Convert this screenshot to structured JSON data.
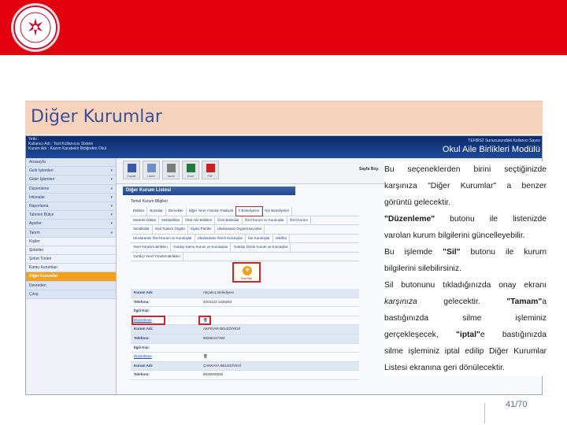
{
  "slide": {
    "title": "Diğer Kurumlar",
    "page_number": "41/70",
    "colors": {
      "top_bar": "#e3000f",
      "title_bar": "#f6d3bd",
      "title_text": "#3b4e9a",
      "highlight": "#d6222a"
    }
  },
  "screenshot": {
    "header": {
      "info_line1": "Yetki :",
      "info_line2": "Kullanıcı Adı   : Test Kullanıcısı Sistem",
      "info_line3": "Kurum Adı        : Kazım Karabekir İlköğretim Okul",
      "right_small": "TEFBİS2 Sunucusundaki Kullanıcı Sayısı",
      "right_title": "Okul Aile Birlikleri Modülü"
    },
    "sidebar": {
      "items": [
        {
          "label": "Anasayfa",
          "style": "dark"
        },
        {
          "label": "Gelir İşlemleri",
          "style": "dark",
          "arrow": "▾"
        },
        {
          "label": "Gider İşlemleri",
          "style": "dark",
          "arrow": "▾"
        },
        {
          "label": "Düzenleme",
          "style": "dark",
          "arrow": "▾"
        },
        {
          "label": "İstisnalar",
          "style": "dark",
          "arrow": "▾"
        },
        {
          "label": "Raporlama",
          "style": "dark",
          "arrow": "▾"
        },
        {
          "label": "Tahmini Bütçe",
          "style": "dark",
          "arrow": "▾"
        },
        {
          "label": "Ayarlar",
          "style": "dark",
          "arrow": "▾"
        },
        {
          "label": "Tanım",
          "style": "dark",
          "arrow": "▾"
        },
        {
          "label": "Kişiler",
          "style": "plain"
        },
        {
          "label": "Şirketler",
          "style": "plain"
        },
        {
          "label": "Şirket Türleri",
          "style": "plain"
        },
        {
          "label": "Kamu Kurumları",
          "style": "plain"
        },
        {
          "label": "Diğer Kurumlar",
          "style": "active"
        },
        {
          "label": "Devreden",
          "style": "dark"
        },
        {
          "label": "Çıkış",
          "style": "dark"
        }
      ]
    },
    "toolbar": {
      "buttons": [
        {
          "label": "Kaydet",
          "icon": "save-icon"
        },
        {
          "label": "Listele",
          "icon": "list-icon"
        },
        {
          "label": "Yazdır",
          "icon": "print-icon"
        },
        {
          "label": "Excel",
          "icon": "excel-icon"
        },
        {
          "label": "PDF",
          "icon": "pdf-icon"
        }
      ],
      "page_selector": "Sayfa Boy."
    },
    "list_title": "Diğer Kurum Listesi",
    "form_header": "Temel Kurum Bilgileri",
    "categories": [
      [
        "Birlikler",
        "Borsalar",
        "Dernekler",
        "Diğer Yerel Yönetim Faaliyeti",
        "İl Belediyeleri",
        "İlçe Belediyeleri"
      ],
      [
        "Mesleki Odalar",
        "Muhtarlıklar",
        "Okul Aile Birlikleri",
        "Özel Bankalar",
        "Özel Kurum ve Kuruluşlar",
        "Özel Kurum"
      ],
      [
        "Sendikalar",
        "Sivil Toplum Örgütü",
        "Siyasi Partiler",
        "Uluslararası Organizasyonlar"
      ],
      [
        "Uluslararası Özel Kurum ve Kuruluşlar",
        "Uluslararası Özerk Kuruluşlar",
        "Üst Kuruluşlar",
        "Vakıflar"
      ],
      [
        "Yerel Yönetim Birlikleri",
        "Yurtdışı Kamu Kurum ve Kuruluşları",
        "Yurtdışı Özerk Kurum ve Kuruluşlar"
      ],
      [
        "Yurtdışı Yerel Yönetim Birlikleri"
      ]
    ],
    "selected_category": "İl Belediyeleri",
    "add_button_label": "Yeni Ekle",
    "records": [
      [
        {
          "key": "Kurum Adı:",
          "value": "Akçakoç Belediyesi",
          "shade": true
        },
        {
          "key": "Telefonu:",
          "value": "4004123 1325264",
          "shade": false
        },
        {
          "key": "İlgili Kişi:",
          "value": "",
          "shade": false
        },
        {
          "key": "Düzenleme",
          "value": "🗑",
          "shade": false,
          "link": true
        }
      ],
      [
        {
          "key": "Kurum Adı:",
          "value": "AKPINAR BELEDİYESİ",
          "shade": true
        },
        {
          "key": "Telefonu:",
          "value": "90286417494",
          "shade": true
        },
        {
          "key": "İlgili Kişi:",
          "value": "",
          "shade": false
        },
        {
          "key": "Düzenleme",
          "value": "🗑",
          "shade": false,
          "link": true
        }
      ],
      [
        {
          "key": "Kurum Adı:",
          "value": "ÇANKAYA BELEDİYESİ",
          "shade": true
        },
        {
          "key": "Telefonu:",
          "value": "9026000000",
          "shade": false
        }
      ]
    ]
  },
  "description": {
    "p1": "Bu seçeneklerden birini seçtiğinizde",
    "p2": "karşınıza \"Diğer Kurumlar\" a benzer",
    "p3": "görüntü gelecektir.",
    "p4_bold": "\"Düzenleme\"",
    "p4_rest": " butonu ile listenizde",
    "p5": "varolan kurum bilgilerini güncelleyebilir.",
    "p6_a": "Bu işlemde ",
    "p6_bold": "\"Sil\"",
    "p6_rest": " butonu ile kurum",
    "p7": "bilgilerini silebilirsiniz.",
    "p8": "Sil butonunu tıkladığınızda onay ekranı",
    "p9_italic": "karşınıza",
    "p9_mid": " gelecektir. ",
    "p9_bold": "\"Tamam\"",
    "p9_tail": "a",
    "p10": "bastığınızda silme işleminiz",
    "p11_a": "gerçekleşecek, ",
    "p11_bold": "\"iptal\"",
    "p11_rest": "e bastığınızda",
    "p12": "silme işleminiz iptal edilip Diğer Kurumlar",
    "p13": "Listesi ekranına geri dönülecektir."
  }
}
